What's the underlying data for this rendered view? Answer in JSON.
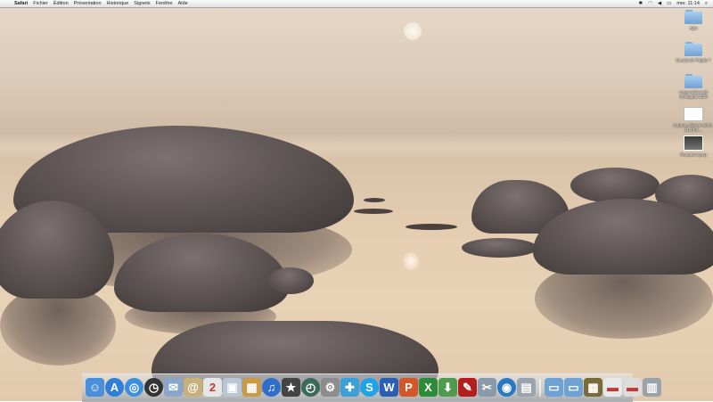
{
  "menubar": {
    "apple_glyph": "",
    "app_name": "Safari",
    "items": [
      "Fichier",
      "Édition",
      "Présentation",
      "Historique",
      "Signets",
      "Fenêtre",
      "Aide"
    ],
    "clock": "mer. 11:14"
  },
  "desktop_icons": [
    {
      "label": "Ajax",
      "kind": "folder"
    },
    {
      "label": "Ne pas de l'Apple ?",
      "kind": "folder"
    },
    {
      "label": "creep radio web montagne 2010",
      "kind": "folder"
    },
    {
      "label": "Capture d'écran 2010-11-10 à ...",
      "kind": "document"
    },
    {
      "label": "Recette ici.png",
      "kind": "image"
    }
  ],
  "dock": {
    "apps": [
      {
        "name": "Finder",
        "color": "#4a8fd8",
        "glyph": "☺"
      },
      {
        "name": "App Store",
        "color": "#2f7fd6",
        "glyph": "A"
      },
      {
        "name": "Safari",
        "color": "#3b8ee0",
        "glyph": "◎"
      },
      {
        "name": "Dashboard",
        "color": "#333333",
        "glyph": "◷"
      },
      {
        "name": "Mail",
        "color": "#8aa6c8",
        "glyph": "✉"
      },
      {
        "name": "Carnet d'adresses",
        "color": "#c8b07a",
        "glyph": "@"
      },
      {
        "name": "iCal",
        "color": "#e6e6e6",
        "glyph": "2"
      },
      {
        "name": "Aperçu",
        "color": "#b9c6d4",
        "glyph": "▣"
      },
      {
        "name": "iPhoto",
        "color": "#c99a4a",
        "glyph": "▦"
      },
      {
        "name": "iTunes",
        "color": "#2f6fc9",
        "glyph": "♫"
      },
      {
        "name": "iMovie",
        "color": "#444444",
        "glyph": "★"
      },
      {
        "name": "Time Machine",
        "color": "#3a6a5a",
        "glyph": "◴"
      },
      {
        "name": "Préférences Système",
        "color": "#8d8d8d",
        "glyph": "⚙"
      },
      {
        "name": "Messenger",
        "color": "#3aa0d8",
        "glyph": "✚"
      },
      {
        "name": "Skype",
        "color": "#1fa3e6",
        "glyph": "S"
      },
      {
        "name": "Word",
        "color": "#2b5fb4",
        "glyph": "W"
      },
      {
        "name": "PowerPoint",
        "color": "#d4572a",
        "glyph": "P"
      },
      {
        "name": "Excel",
        "color": "#2e8b3a",
        "glyph": "X"
      },
      {
        "name": "Transmission",
        "color": "#4f9a4f",
        "glyph": "⬇"
      },
      {
        "name": "Acrobat",
        "color": "#b21e1e",
        "glyph": "✎"
      },
      {
        "name": "Utilitaire",
        "color": "#8a9aaa",
        "glyph": "✂"
      },
      {
        "name": "Spotlight Web",
        "color": "#2878c8",
        "glyph": "◉"
      },
      {
        "name": "Aperçu Photo",
        "color": "#9aa4ae",
        "glyph": "▤"
      }
    ],
    "stacks": [
      {
        "name": "Applications",
        "color": "#6fa2d4",
        "glyph": "▭"
      },
      {
        "name": "Documents",
        "color": "#6fa2d4",
        "glyph": "▭"
      },
      {
        "name": "Photo",
        "color": "#7a6a3a",
        "glyph": "▩"
      },
      {
        "name": "Téléchargements",
        "color": "#e8e8e8",
        "glyph": "▬"
      },
      {
        "name": "Fenêtre",
        "color": "#dcdcdc",
        "glyph": "▬"
      },
      {
        "name": "Corbeille",
        "color": "#9aa2aa",
        "glyph": "▥"
      }
    ]
  }
}
